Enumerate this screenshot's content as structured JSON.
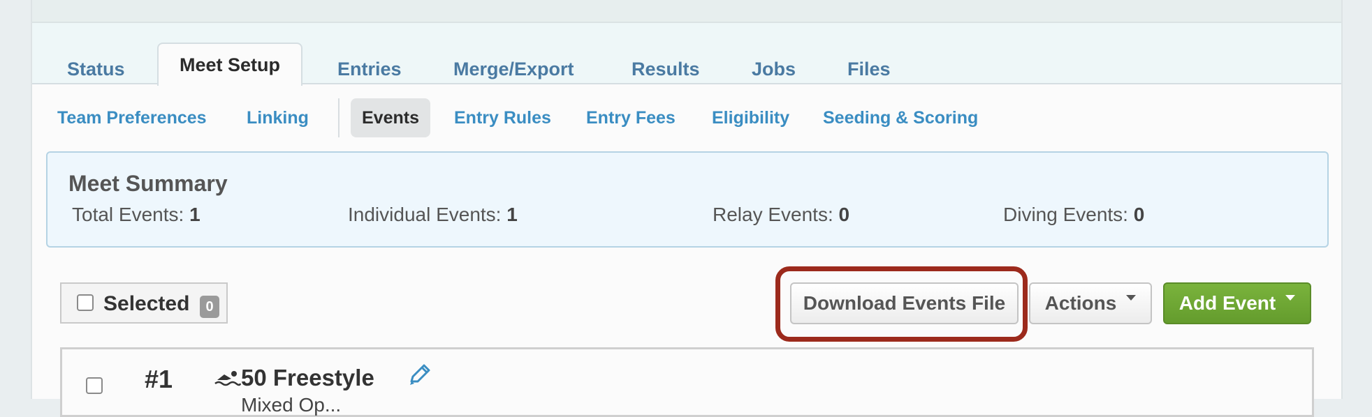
{
  "tabs": [
    "Status",
    "Meet Setup",
    "Entries",
    "Merge/Export",
    "Results",
    "Jobs",
    "Files"
  ],
  "subnav": [
    "Team Preferences",
    "Linking",
    "Events",
    "Entry Rules",
    "Entry Fees",
    "Eligibility",
    "Seeding & Scoring"
  ],
  "summary": {
    "title": "Meet Summary",
    "total_label": "Total Events:",
    "total_value": "1",
    "individual_label": "Individual Events:",
    "individual_value": "1",
    "relay_label": "Relay Events:",
    "relay_value": "0",
    "diving_label": "Diving Events:",
    "diving_value": "0"
  },
  "toolbar": {
    "selected_label": "Selected",
    "selected_count": "0",
    "download_label": "Download Events File",
    "actions_label": "Actions",
    "add_event_label": "Add Event"
  },
  "event": {
    "number": "#1",
    "name": "50 Freestyle",
    "subtitle": "Mixed Op..."
  },
  "colors": {
    "accent": "#3a8dc2",
    "highlight": "#9c2a1c",
    "add_button": "#6fa835"
  },
  "icons": [
    "swimmer-icon",
    "pencil-icon",
    "caret-down-icon"
  ]
}
